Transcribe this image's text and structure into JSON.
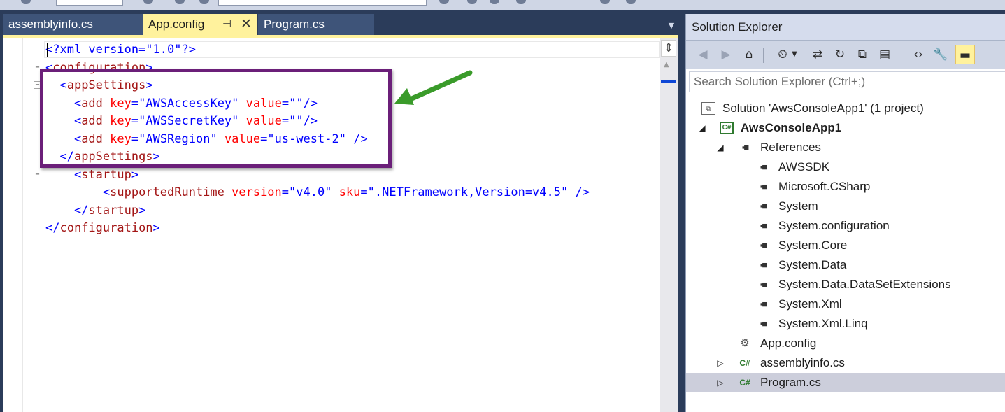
{
  "editor": {
    "tabs": [
      {
        "label": "assemblyinfo.cs",
        "active": false
      },
      {
        "label": "App.config",
        "active": true
      },
      {
        "label": "Program.cs",
        "active": false
      }
    ],
    "tab_pin_glyph": "⊣",
    "tab_close_glyph": "✕",
    "lines": [
      [
        {
          "t": "<?xml version=\"1.0\"?>",
          "c": "xml-punct"
        }
      ],
      [
        {
          "t": "<",
          "c": "xml-punct"
        },
        {
          "t": "configuration",
          "c": "xml-tag"
        },
        {
          "t": ">",
          "c": "xml-punct"
        }
      ],
      [
        {
          "t": "  <",
          "c": "xml-punct"
        },
        {
          "t": "appSettings",
          "c": "xml-tag"
        },
        {
          "t": ">",
          "c": "xml-punct"
        }
      ],
      [
        {
          "t": "    <",
          "c": "xml-punct"
        },
        {
          "t": "add",
          "c": "xml-tag"
        },
        {
          "t": " key",
          "c": "xml-attr"
        },
        {
          "t": "=",
          "c": "xml-punct"
        },
        {
          "t": "\"AWSAccessKey\"",
          "c": "xml-val"
        },
        {
          "t": " value",
          "c": "xml-attr"
        },
        {
          "t": "=",
          "c": "xml-punct"
        },
        {
          "t": "\"\"",
          "c": "xml-val"
        },
        {
          "t": "/>",
          "c": "xml-punct"
        }
      ],
      [
        {
          "t": "    <",
          "c": "xml-punct"
        },
        {
          "t": "add",
          "c": "xml-tag"
        },
        {
          "t": " key",
          "c": "xml-attr"
        },
        {
          "t": "=",
          "c": "xml-punct"
        },
        {
          "t": "\"AWSSecretKey\"",
          "c": "xml-val"
        },
        {
          "t": " value",
          "c": "xml-attr"
        },
        {
          "t": "=",
          "c": "xml-punct"
        },
        {
          "t": "\"\"",
          "c": "xml-val"
        },
        {
          "t": "/>",
          "c": "xml-punct"
        }
      ],
      [
        {
          "t": "    <",
          "c": "xml-punct"
        },
        {
          "t": "add",
          "c": "xml-tag"
        },
        {
          "t": " key",
          "c": "xml-attr"
        },
        {
          "t": "=",
          "c": "xml-punct"
        },
        {
          "t": "\"AWSRegion\"",
          "c": "xml-val"
        },
        {
          "t": " value",
          "c": "xml-attr"
        },
        {
          "t": "=",
          "c": "xml-punct"
        },
        {
          "t": "\"us-west-2\"",
          "c": "xml-val"
        },
        {
          "t": " />",
          "c": "xml-punct"
        }
      ],
      [
        {
          "t": "  </",
          "c": "xml-punct"
        },
        {
          "t": "appSettings",
          "c": "xml-tag"
        },
        {
          "t": ">",
          "c": "xml-punct"
        }
      ],
      [
        {
          "t": "    <",
          "c": "xml-punct"
        },
        {
          "t": "startup",
          "c": "xml-tag"
        },
        {
          "t": ">",
          "c": "xml-punct"
        }
      ],
      [
        {
          "t": "        <",
          "c": "xml-punct"
        },
        {
          "t": "supportedRuntime",
          "c": "xml-tag"
        },
        {
          "t": " version",
          "c": "xml-attr"
        },
        {
          "t": "=",
          "c": "xml-punct"
        },
        {
          "t": "\"v4.0\"",
          "c": "xml-val"
        },
        {
          "t": " sku",
          "c": "xml-attr"
        },
        {
          "t": "=",
          "c": "xml-punct"
        },
        {
          "t": "\".NETFramework,Version=v4.5\"",
          "c": "xml-val"
        },
        {
          "t": " />",
          "c": "xml-punct"
        }
      ],
      [
        {
          "t": "    </",
          "c": "xml-punct"
        },
        {
          "t": "startup",
          "c": "xml-tag"
        },
        {
          "t": ">",
          "c": "xml-punct"
        }
      ],
      [
        {
          "t": "</",
          "c": "xml-punct"
        },
        {
          "t": "configuration",
          "c": "xml-tag"
        },
        {
          "t": ">",
          "c": "xml-punct"
        }
      ]
    ],
    "colors": {
      "tag": "#a31515",
      "attribute": "#ff0000",
      "value": "#0000ff",
      "punctuation": "#0000ff"
    }
  },
  "solution_explorer": {
    "title": "Solution Explorer",
    "search_placeholder": "Search Solution Explorer (Ctrl+;)",
    "toolbar_icons": [
      "back-icon",
      "forward-icon",
      "home-icon",
      "history-icon",
      "dropdown-icon",
      "sync-icon",
      "refresh-icon",
      "collapse-all-icon",
      "show-all-files-icon",
      "view-code-icon",
      "properties-icon",
      "preview-icon"
    ],
    "tree": [
      {
        "label": "Solution 'AwsConsoleApp1' (1 project)",
        "icon": "solution-icon",
        "bold": false
      },
      {
        "label": "AwsConsoleApp1",
        "icon": "csharp-project-icon",
        "bold": true
      },
      {
        "label": "References",
        "icon": "references-icon",
        "bold": false
      },
      {
        "label": "AWSSDK",
        "icon": "reference-icon",
        "bold": false
      },
      {
        "label": "Microsoft.CSharp",
        "icon": "reference-icon",
        "bold": false
      },
      {
        "label": "System",
        "icon": "reference-icon",
        "bold": false
      },
      {
        "label": "System.configuration",
        "icon": "reference-icon",
        "bold": false
      },
      {
        "label": "System.Core",
        "icon": "reference-icon",
        "bold": false
      },
      {
        "label": "System.Data",
        "icon": "reference-icon",
        "bold": false
      },
      {
        "label": "System.Data.DataSetExtensions",
        "icon": "reference-icon",
        "bold": false
      },
      {
        "label": "System.Xml",
        "icon": "reference-icon",
        "bold": false
      },
      {
        "label": "System.Xml.Linq",
        "icon": "reference-icon",
        "bold": false
      },
      {
        "label": "App.config",
        "icon": "config-file-icon",
        "bold": false
      },
      {
        "label": "assemblyinfo.cs",
        "icon": "csharp-file-icon",
        "bold": false
      },
      {
        "label": "Program.cs",
        "icon": "csharp-file-icon",
        "bold": false,
        "selected": true
      }
    ],
    "icon_glyphs": {
      "csharp": "C#",
      "reference": "▪■",
      "solution": "⧉",
      "config": "⚙"
    }
  },
  "annotations": {
    "box_color": "#6b1f79",
    "arrow_color": "#3a9b2a"
  }
}
